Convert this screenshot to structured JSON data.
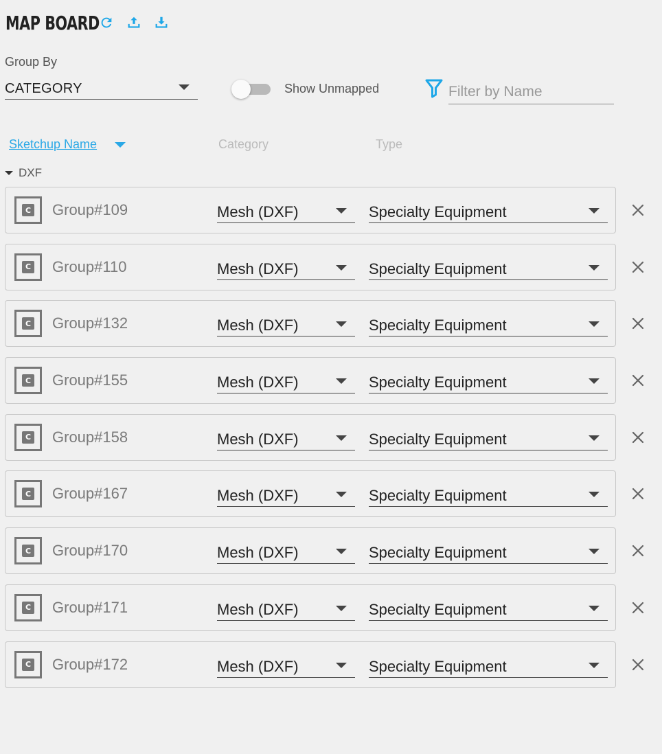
{
  "header": {
    "title": "MAP BOARD",
    "icons": [
      "refresh-icon",
      "upload-icon",
      "download-icon"
    ],
    "accent_color": "#1ea7e8"
  },
  "group_by": {
    "label": "Group By",
    "value": "CATEGORY"
  },
  "toggle": {
    "label": "Show Unmapped",
    "on": false
  },
  "filter": {
    "placeholder": "Filter by Name",
    "value": ""
  },
  "columns": {
    "sketchup_name": "Sketchup Name",
    "category": "Category",
    "type": "Type"
  },
  "group": {
    "name": "DXF",
    "expanded": true
  },
  "rows": [
    {
      "name": "Group#109",
      "category": "Mesh (DXF)",
      "type": "Specialty Equipment"
    },
    {
      "name": "Group#110",
      "category": "Mesh (DXF)",
      "type": "Specialty Equipment"
    },
    {
      "name": "Group#132",
      "category": "Mesh (DXF)",
      "type": "Specialty Equipment"
    },
    {
      "name": "Group#155",
      "category": "Mesh (DXF)",
      "type": "Specialty Equipment"
    },
    {
      "name": "Group#158",
      "category": "Mesh (DXF)",
      "type": "Specialty Equipment"
    },
    {
      "name": "Group#167",
      "category": "Mesh (DXF)",
      "type": "Specialty Equipment"
    },
    {
      "name": "Group#170",
      "category": "Mesh (DXF)",
      "type": "Specialty Equipment"
    },
    {
      "name": "Group#171",
      "category": "Mesh (DXF)",
      "type": "Specialty Equipment"
    },
    {
      "name": "Group#172",
      "category": "Mesh (DXF)",
      "type": "Specialty Equipment"
    }
  ],
  "row_icon_letter": "C"
}
